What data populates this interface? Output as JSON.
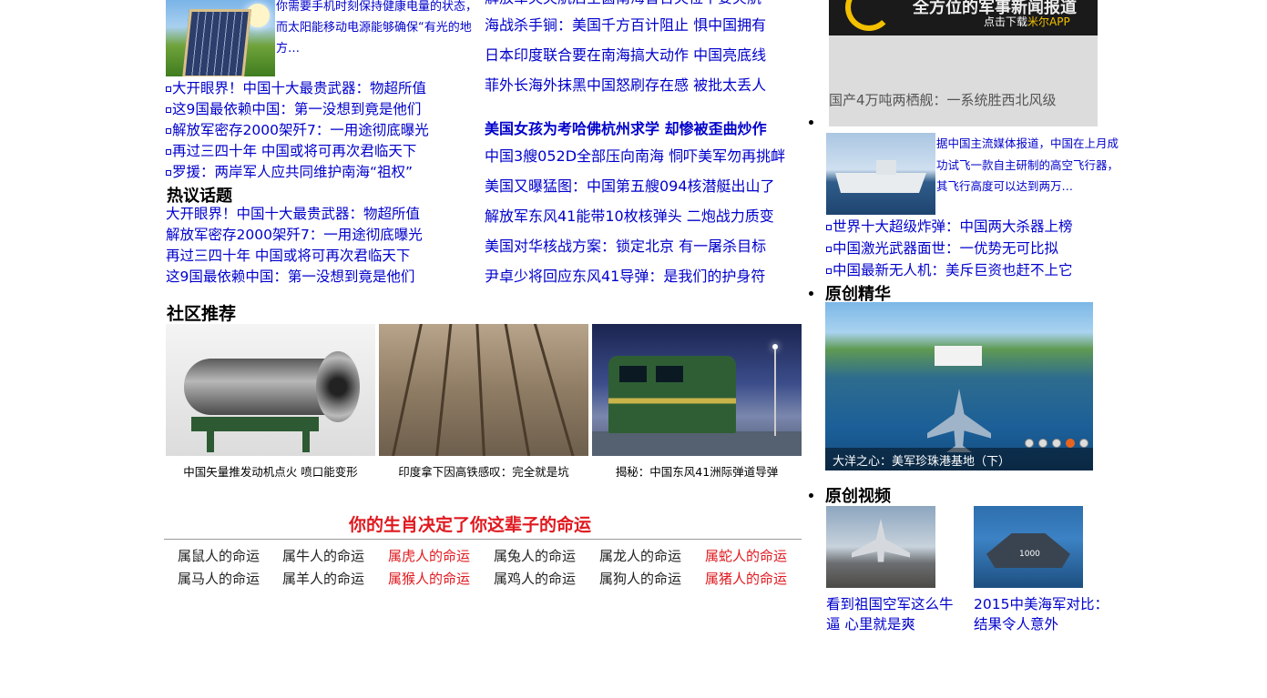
{
  "left": {
    "solar_desc": "你需要手机时刻保持健康电量的状态，而太阳能移动电源能够确保“有光的地方…",
    "bullets": [
      "大开眼界！中国十大最贵武器：物超所值",
      "这9国最依赖中国：第一没想到竟是他们",
      "解放军密存2000架歼7：一用途彻底曝光",
      "再过三四十年 中国或将可再次君临天下",
      "罗援：两岸军人应共同维护南海“祖权”"
    ],
    "hot_title": "热议话题",
    "hot_links": [
      "大开眼界！中国十大最贵武器：物超所值",
      "解放军密存2000架歼7：一用途彻底曝光",
      "再过三四十年 中国或将可再次君临天下",
      "这9国最依赖中国：第一没想到竟是他们"
    ]
  },
  "middle": {
    "top_partial": "解放军央央航后空菌南海普告央位不要夹航",
    "links_a": [
      "海战杀手锏：美国千方百计阻止 惧中国拥有",
      "日本印度联合要在南海搞大动作 中国亮底线",
      "菲外长海外抹黑中国怒刷存在感 被批太丢人"
    ],
    "bold_link": "美国女孩为考哈佛杭州求学 却惨被歪曲炒作",
    "links_b": [
      "中国3艘052D全部压向南海 恫吓美军勿再挑衅",
      "美国又曝猛图：中国第五艘094核潜艇出山了",
      "解放军东风41能带10枚核弹头 二炮战力质变",
      "美国对华核战方案：锁定北京 有一屠杀目标",
      "尹卓少将回应东风41导弹：是我们的护身符"
    ]
  },
  "community": {
    "title": "社区推荐",
    "items": [
      {
        "caption": "中国矢量推发动机点火 喷口能变形"
      },
      {
        "caption": "印度拿下因高铁感叹：完全就是坑"
      },
      {
        "caption": "揭秘：中国东风41洲际弹道导弹"
      }
    ]
  },
  "zodiac": {
    "title": "你的生肖决定了你这辈子的命运",
    "row1": [
      {
        "label": "属鼠人的命运",
        "red": false
      },
      {
        "label": "属牛人的命运",
        "red": false
      },
      {
        "label": "属虎人的命运",
        "red": true
      },
      {
        "label": "属兔人的命运",
        "red": false
      },
      {
        "label": "属龙人的命运",
        "red": false
      },
      {
        "label": "属蛇人的命运",
        "red": true
      }
    ],
    "row2": [
      {
        "label": "属马人的命运",
        "red": false
      },
      {
        "label": "属羊人的命运",
        "red": false
      },
      {
        "label": "属猴人的命运",
        "red": true
      },
      {
        "label": "属鸡人的命运",
        "red": false
      },
      {
        "label": "属狗人的命运",
        "red": false
      },
      {
        "label": "属猪人的命运",
        "red": true
      }
    ]
  },
  "right": {
    "ad_big": "全方位的军事新闻报道",
    "ad_small_prefix": "点击下载",
    "ad_small_app": "米尔APP",
    "ad_caption": "国产4万吨两栖舰：一系统胜西北风级",
    "ship_desc": "据中国主流媒体报道，中国在上月成功试飞一款自主研制的高空飞行器，其飞行高度可以达到两万…",
    "bullets": [
      "世界十大超级炸弹：中国两大杀器上榜",
      "中国激光武器面世：一优势无可比拟",
      "中国最新无人机：美斥巨资也赶不上它"
    ],
    "feature_title": "原创精华",
    "feature_caption": "大洋之心：美军珍珠港基地（下）",
    "feature_active_slide": 4,
    "video_title": "原创视频",
    "videos": [
      {
        "line1": "看到祖国空军这么牛",
        "line2": "逼 心里就是爽"
      },
      {
        "line1": "2015中美海军对比：",
        "line2": "结果令人意外"
      }
    ],
    "colors": {
      "link": "#0000cc",
      "accent_red": "#e0191f",
      "ad_yellow": "#f3c000",
      "active_dot": "#e8641e"
    }
  }
}
